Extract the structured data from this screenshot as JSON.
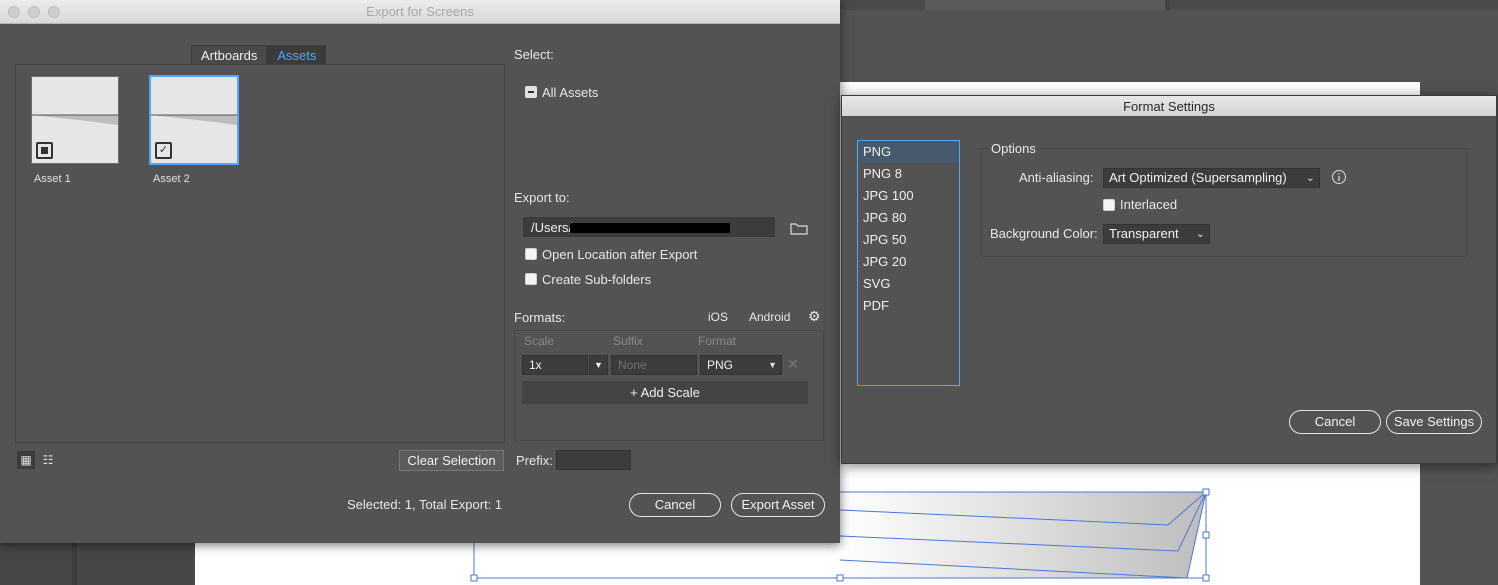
{
  "export_dialog": {
    "title": "Export for Screens",
    "tabs": [
      "Artboards",
      "Assets"
    ],
    "assets": [
      {
        "label": "Asset 1",
        "checked": false
      },
      {
        "label": "Asset 2",
        "checked": true
      }
    ],
    "clear_selection": "Clear Selection",
    "status": "Selected: 1, Total Export: 1",
    "select_label": "Select:",
    "all_assets": "All Assets",
    "export_to_label": "Export to:",
    "export_path": "/Users/",
    "open_location": "Open Location after Export",
    "create_subfolders": "Create Sub-folders",
    "formats_label": "Formats:",
    "ios": "iOS",
    "android": "Android",
    "col_scale": "Scale",
    "col_suffix": "Suffix",
    "col_format": "Format",
    "scale_value": "1x",
    "suffix_placeholder": "None",
    "format_value": "PNG",
    "add_scale": "+ Add Scale",
    "prefix_label": "Prefix:",
    "cancel": "Cancel",
    "export_asset": "Export Asset"
  },
  "format_settings": {
    "title": "Format Settings",
    "formats": [
      "PNG",
      "PNG 8",
      "JPG 100",
      "JPG 80",
      "JPG 50",
      "JPG 20",
      "SVG",
      "PDF"
    ],
    "selected_format": "PNG",
    "options_label": "Options",
    "anti_aliasing_label": "Anti-aliasing:",
    "anti_aliasing_value": "Art Optimized (Supersampling)",
    "interlaced": "Interlaced",
    "bg_color_label": "Background Color:",
    "bg_color_value": "Transparent",
    "cancel": "Cancel",
    "save_settings": "Save Settings"
  },
  "colors": {
    "accent": "#4ea6ff",
    "dialog_bg": "#535353",
    "field_bg": "#3c3c3c"
  }
}
